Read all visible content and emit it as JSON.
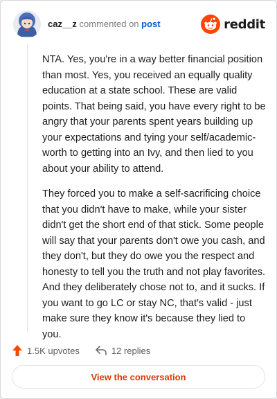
{
  "comment": {
    "username": "caz__z",
    "action_text": "commented on",
    "target_link": "post",
    "brand": "reddit",
    "paragraphs": [
      "NTA. Yes, you're in a way better financial position than most. Yes, you received an equally quality education at a state school. These are valid points. That being said, you have every right to be angry that your parents spent years building up your expectations and tying your self/academic-worth to getting into an Ivy, and then lied to you about your ability to attend.",
      "They forced you to make a self-sacrificing choice that you didn't have to make, while your sister didn't get the short end of that stick. Some people will say that your parents don't owe you cash, and they don't, but they do owe you the respect and honesty to tell you the truth and not play favorites. And they deliberately chose not to, and it sucks. If you want to go LC or stay NC, that's valid - just make sure they know it's because they lied to you."
    ]
  },
  "actions": {
    "upvotes": "1.5K upvotes",
    "replies": "12 replies"
  },
  "cta_label": "View the conversation",
  "colors": {
    "brand_orange": "#ff4500",
    "link_blue": "#0a5ec7",
    "cta_text": "#d93a00"
  },
  "icons": {
    "avatar": "anime-avatar",
    "logo": "reddit-snoo-icon",
    "upvote": "upvote-arrow-icon",
    "reply": "reply-arrow-icon"
  }
}
